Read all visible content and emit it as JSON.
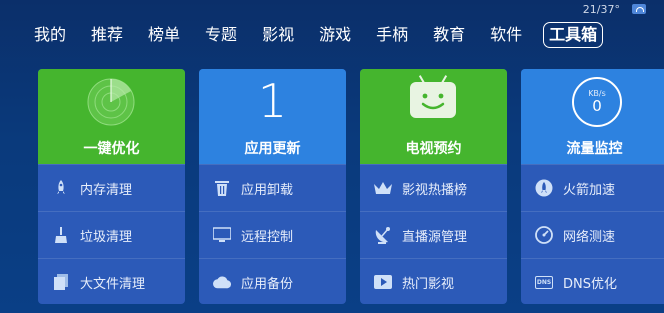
{
  "status": {
    "weather": "21/37°"
  },
  "tabs": [
    "我的",
    "推荐",
    "榜单",
    "专题",
    "影视",
    "游戏",
    "手柄",
    "教育",
    "软件",
    "工具箱"
  ],
  "active_tab": "工具箱",
  "tiles": [
    {
      "title": "一键优化",
      "items": [
        "内存清理",
        "垃圾清理",
        "大文件清理"
      ]
    },
    {
      "title": "应用更新",
      "count": "1",
      "items": [
        "应用卸载",
        "远程控制",
        "应用备份"
      ]
    },
    {
      "title": "电视预约",
      "items": [
        "影视热播榜",
        "直播源管理",
        "热门影视"
      ]
    },
    {
      "title": "流量监控",
      "speed_unit": "KB/s",
      "speed_value": "0",
      "items": [
        "火箭加速",
        "网络测速",
        "DNS优化"
      ],
      "dns_icon_text": "DNS"
    }
  ],
  "colors": {
    "tile_green": "#45b52e",
    "tile_blue": "#2d82e0",
    "tile_body": "#2c5ab8",
    "background": "#0a3a7c"
  }
}
